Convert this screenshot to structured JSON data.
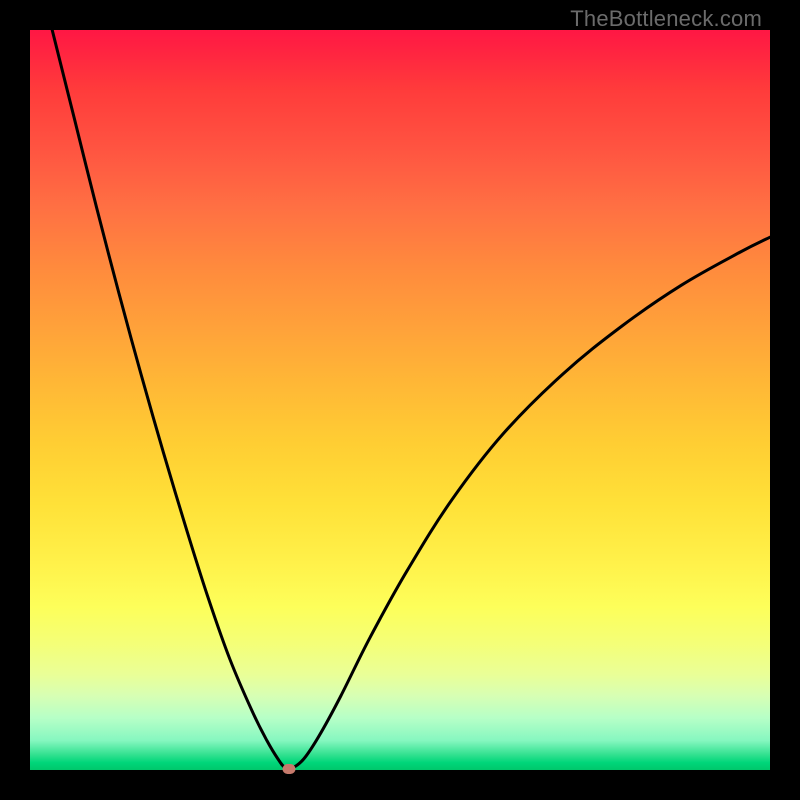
{
  "watermark": "TheBottleneck.com",
  "chart_data": {
    "type": "line",
    "title": "",
    "xlabel": "",
    "ylabel": "",
    "xlim": [
      0,
      100
    ],
    "ylim": [
      0,
      100
    ],
    "axes_shown": false,
    "grid": false,
    "background": "rainbow-vertical-gradient",
    "gradient_stops": [
      {
        "pos": 0,
        "color": "#ff1744"
      },
      {
        "pos": 50,
        "color": "#ffce33"
      },
      {
        "pos": 80,
        "color": "#fdff5a"
      },
      {
        "pos": 100,
        "color": "#00c76b"
      }
    ],
    "series": [
      {
        "name": "bottleneck-curve",
        "color": "#000000",
        "stroke_width": 3,
        "x": [
          3,
          6,
          9,
          12,
          15,
          18,
          21,
          24,
          27,
          30,
          32,
          33.5,
          34.5,
          35.5,
          37,
          39,
          42,
          46,
          51,
          57,
          64,
          72,
          80,
          88,
          96,
          100
        ],
        "y": [
          100,
          88,
          76,
          64.5,
          53.5,
          43,
          33,
          23.5,
          15,
          8,
          4,
          1.5,
          0.3,
          0.3,
          1.5,
          4.5,
          10,
          18,
          27,
          36.5,
          45.5,
          53.5,
          60,
          65.5,
          70,
          72
        ]
      }
    ],
    "marker": {
      "x": 35,
      "y": 0.2,
      "color": "#c67a6c"
    }
  }
}
